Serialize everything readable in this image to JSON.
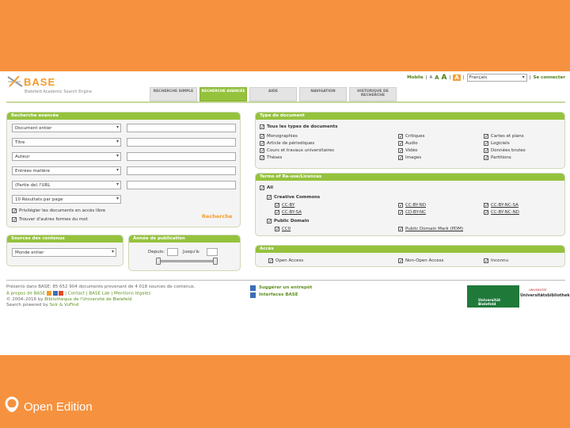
{
  "header": {
    "logo": "BASE",
    "subtitle": "Bielefeld Academic Search Engine",
    "mobile": "Mobile",
    "font_small": "A",
    "font_mid": "A",
    "font_big": "A",
    "font_box": "A",
    "language": "Français",
    "login": "Se connecter"
  },
  "tabs": [
    {
      "label": "RECHERCHE SIMPLE"
    },
    {
      "label": "RECHERCHE AVANCÉE"
    },
    {
      "label": "AIDE"
    },
    {
      "label": "NAVIGATION"
    },
    {
      "label": "HISTORIQUE DE RECHERCHE"
    }
  ],
  "advanced": {
    "title": "Recherche avancée",
    "fields": [
      "Document entier",
      "Titre",
      "Auteur",
      "Entrées matière",
      "(Partie de) l'URL",
      "10 Résultats par page"
    ],
    "opt_open": "Privilégier les documents en accès libre",
    "opt_forms": "Trouver d'autres formes du mot",
    "search_button": "Recherche"
  },
  "sources": {
    "title": "Sources des contenus",
    "value": "Monde entier"
  },
  "pubyear": {
    "title": "Année de publication",
    "from": "Depuis:",
    "to": "Jusqu'à:"
  },
  "doctype": {
    "title": "Type de document",
    "all": "Tous les types de documents",
    "items": [
      [
        "Monographies",
        "Critiques",
        "Cartes et plans"
      ],
      [
        "Article de périodiques",
        "Audio",
        "Logiciels"
      ],
      [
        "Cours et travaux universitaires",
        "Vidéo",
        "Données brutes"
      ],
      [
        "Thèses",
        "Images",
        "Partitions"
      ]
    ]
  },
  "licences": {
    "title": "Terms of Re-use/Licences",
    "all": "All",
    "cc": "Creative Commons",
    "cc_items": [
      [
        "CC-BY",
        "CC-BY-ND",
        "CC-BY-NC-SA"
      ],
      [
        "CC-BY-SA",
        "CD-BY-NC",
        "CC-BY-NC-ND"
      ]
    ],
    "pd": "Public Domain",
    "pd_items": [
      "CC0",
      "Public Domain Mark (PDM)"
    ]
  },
  "access": {
    "title": "Accès",
    "items": [
      "Open Access",
      "Non-Open Access",
      "Inconnu"
    ]
  },
  "footer": {
    "line1": "Présents dans BASE: 85 652 904 documents provenant de 4 018 sources de contenus.",
    "line2a": "À propos de BASE",
    "line2b": "| Contact | BASE Lab | Mentions légales",
    "line3a": "© 2004–2016 by",
    "line3b": "Bibliothèque de l'Université de Bielefeld",
    "line4a": "Search powered by",
    "line4b": "Solr & VuFind",
    "suggest": "Suggérer un entrepôt",
    "interfaces": "Interfaces BASE",
    "uni": "Universität Bielefeld",
    "uni2": "Universitätsbibliothek",
    "uni_small": "UNIVERSITÄT"
  },
  "brand": {
    "name": "Open Edition"
  }
}
